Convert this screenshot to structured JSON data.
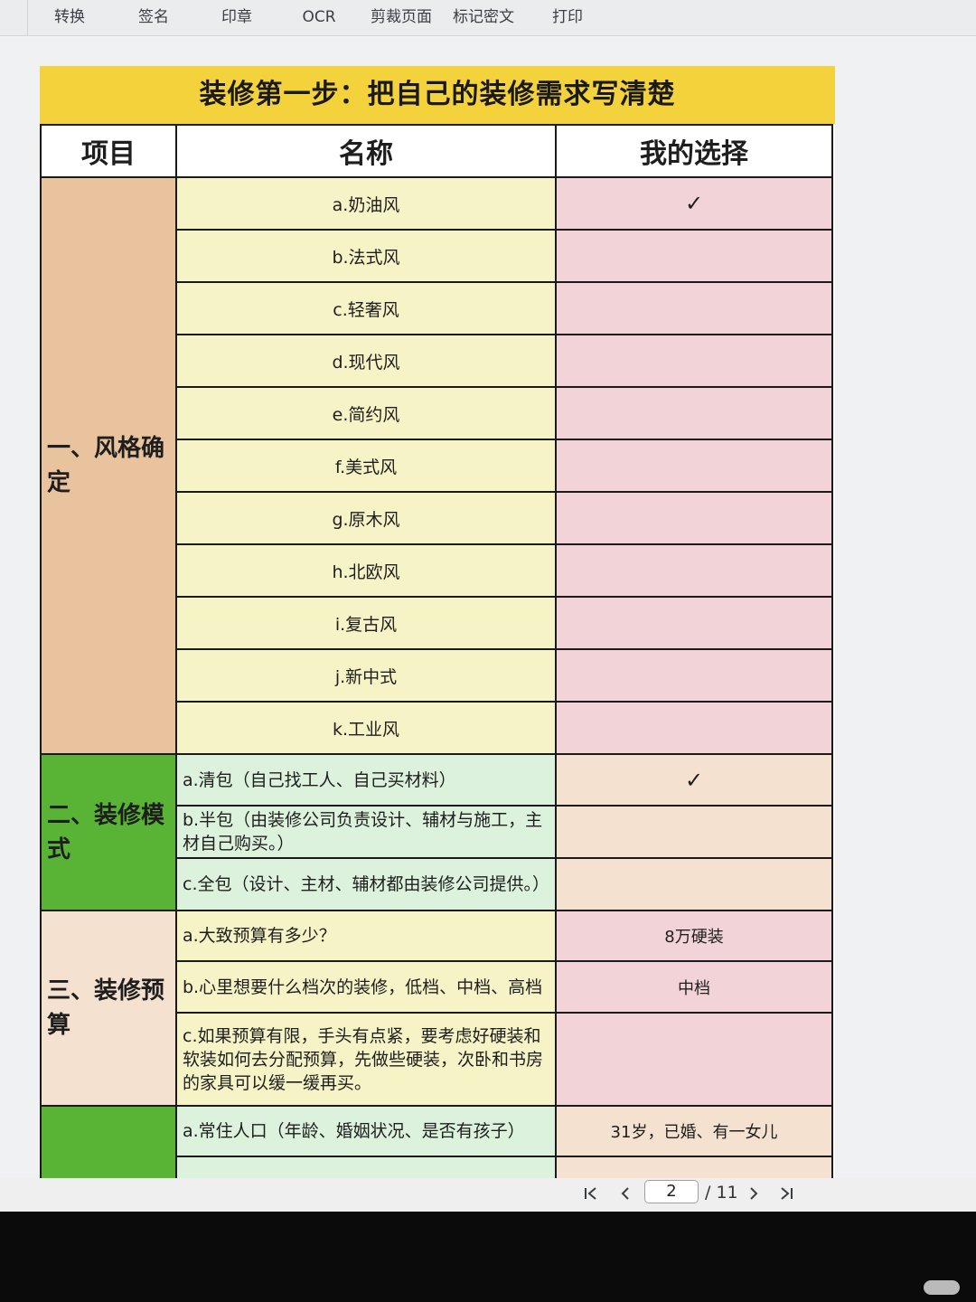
{
  "toolbar": {
    "items": [
      "转换",
      "签名",
      "印章",
      "OCR",
      "剪裁页面",
      "标记密文",
      "打印"
    ]
  },
  "sheet": {
    "title": "装修第一步：把自己的装修需求写清楚",
    "headers": {
      "item": "项目",
      "name": "名称",
      "choice": "我的选择"
    },
    "sections": [
      {
        "category": "一、风格确定",
        "rows": [
          {
            "name": "a.奶油风",
            "choice": "✓"
          },
          {
            "name": "b.法式风",
            "choice": ""
          },
          {
            "name": "c.轻奢风",
            "choice": ""
          },
          {
            "name": "d.现代风",
            "choice": ""
          },
          {
            "name": "e.简约风",
            "choice": ""
          },
          {
            "name": "f.美式风",
            "choice": ""
          },
          {
            "name": "g.原木风",
            "choice": ""
          },
          {
            "name": "h.北欧风",
            "choice": ""
          },
          {
            "name": "i.复古风",
            "choice": ""
          },
          {
            "name": "j.新中式",
            "choice": ""
          },
          {
            "name": "k.工业风",
            "choice": ""
          }
        ]
      },
      {
        "category": "二、装修模式",
        "rows": [
          {
            "name": "a.清包（自己找工人、自己买材料）",
            "choice": "✓"
          },
          {
            "name": "b.半包（由装修公司负责设计、辅材与施工，主材自己购买。）",
            "choice": ""
          },
          {
            "name": "c.全包（设计、主材、辅材都由装修公司提供。）",
            "choice": ""
          }
        ]
      },
      {
        "category": "三、装修预算",
        "rows": [
          {
            "name": "a.大致预算有多少？",
            "choice": "8万硬装"
          },
          {
            "name": "b.心里想要什么档次的装修，低档、中档、高档",
            "choice": "中档"
          },
          {
            "name": "c.如果预算有限，手头有点紧，要考虑好硬装和软装如何去分配预算，先做些硬装，次卧和书房的家具可以缓一缓再买。",
            "choice": ""
          }
        ]
      },
      {
        "category": "",
        "rows": [
          {
            "name": "a.常住人口（年龄、婚姻状况、是否有孩子）",
            "choice": "31岁，已婚、有一女儿"
          },
          {
            "name": "",
            "choice": ""
          }
        ]
      }
    ]
  },
  "pager": {
    "first_icon": "first-page-icon",
    "prev_icon": "prev-page-icon",
    "next_icon": "next-page-icon",
    "last_icon": "last-page-icon",
    "current_page": "2",
    "total_label": "/ 11"
  }
}
